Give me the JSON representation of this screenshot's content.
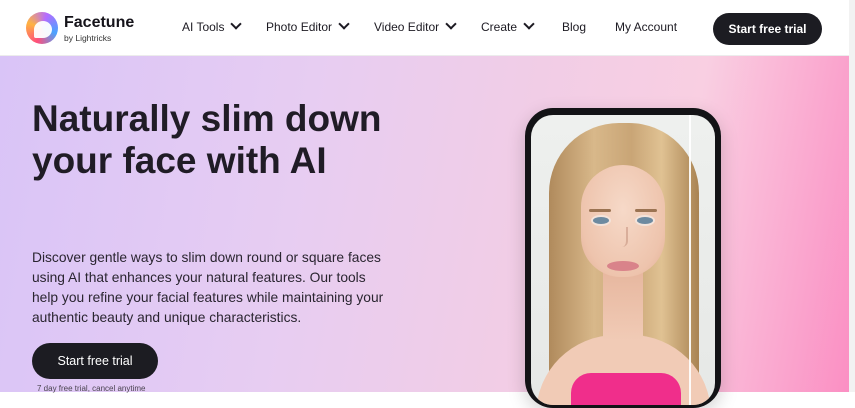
{
  "header": {
    "brand": "Facetune",
    "brand_sub": "by Lightricks",
    "nav": [
      {
        "label": "AI Tools",
        "dropdown": true
      },
      {
        "label": "Photo Editor",
        "dropdown": true
      },
      {
        "label": "Video Editor",
        "dropdown": true
      },
      {
        "label": "Create",
        "dropdown": true
      },
      {
        "label": "Blog",
        "dropdown": false
      },
      {
        "label": "My Account",
        "dropdown": false
      }
    ],
    "cta_label": "Start free trial"
  },
  "hero": {
    "title": "Naturally slim down your face with AI",
    "description": "Discover gentle ways to slim down round or square faces using AI that enhances your natural features. Our tools help you refine your facial features while maintaining your authentic beauty and unique characteristics.",
    "cta_label": "Start free trial",
    "note": "7 day free trial, cancel anytime"
  },
  "colors": {
    "dark_button": "#1c1c22",
    "hero_gradient_start": "#d9c4f7",
    "hero_gradient_end": "#fb8fc3"
  }
}
